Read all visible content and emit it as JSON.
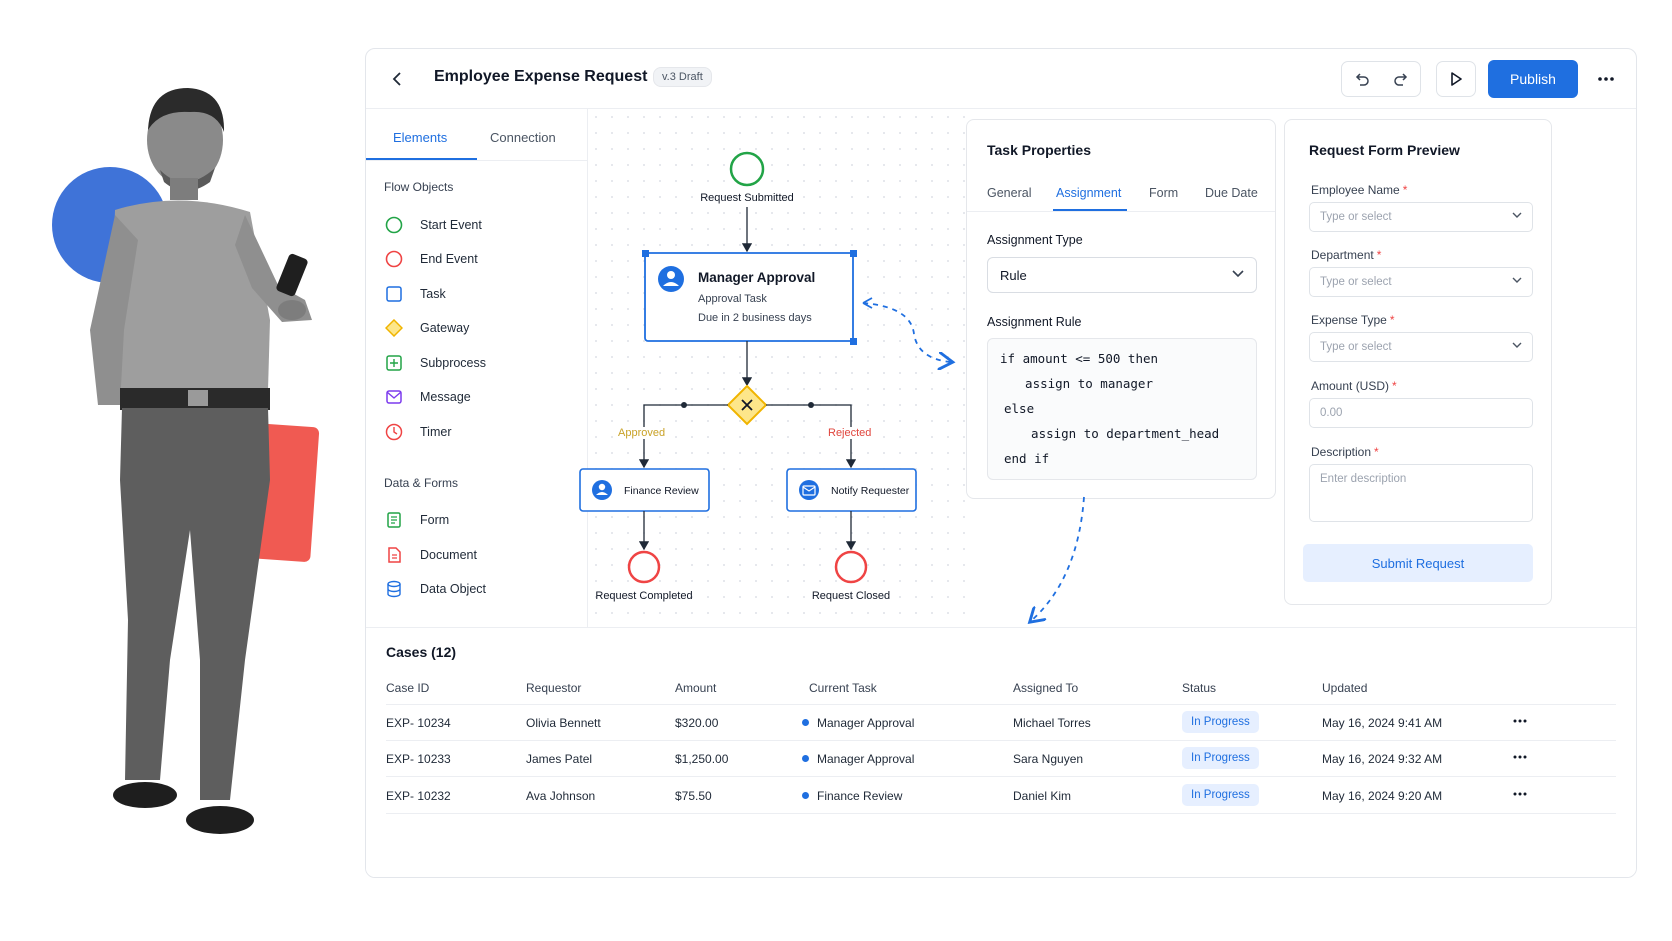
{
  "header": {
    "title": "Employee Expense Request",
    "version": "v.3 Draft",
    "publish_label": "Publish"
  },
  "palette": {
    "tabs": [
      "Elements",
      "Connection"
    ],
    "flow_objects_label": "Flow Objects",
    "flow_objects": [
      "Start Event",
      "End Event",
      "Task",
      "Gateway",
      "Subprocess",
      "Message",
      "Timer"
    ],
    "data_forms_label": "Data & Forms",
    "data_forms": [
      "Form",
      "Document",
      "Data Object"
    ]
  },
  "diagram": {
    "start_label": "Request Submitted",
    "main_task": {
      "title": "Manager Approval",
      "subtitle": "Approval Task",
      "due": "Due in 2 business days"
    },
    "approved_label": "Approved",
    "rejected_label": "Rejected",
    "finance_task": "Finance Review",
    "notify_task": "Notify Requester",
    "end_completed": "Request Completed",
    "end_closed": "Request Closed"
  },
  "task_properties": {
    "title": "Task Properties",
    "tabs": [
      "General",
      "Assignment",
      "Form",
      "Due Date"
    ],
    "assignment_type_label": "Assignment Type",
    "assignment_type_value": "Rule",
    "assignment_rule_label": "Assignment Rule",
    "code": [
      "if amount <= 500 then",
      "  assign to manager",
      "else",
      "  assign to department_head",
      "end if"
    ]
  },
  "form_preview": {
    "title": "Request Form Preview",
    "fields": [
      {
        "label": "Employee Name",
        "placeholder": "Type or select"
      },
      {
        "label": "Department",
        "placeholder": "Type or select"
      },
      {
        "label": "Expense Type",
        "placeholder": "Type or select"
      },
      {
        "label": "Amount (USD)",
        "placeholder": "0.00"
      },
      {
        "label": "Description",
        "placeholder": "Enter description"
      }
    ],
    "required_mark": "*",
    "submit_label": "Submit Request"
  },
  "cases": {
    "title": "Cases (12)",
    "columns": [
      "Case ID",
      "Requestor",
      "Amount",
      "Current Task",
      "Assigned To",
      "Status",
      "Updated"
    ],
    "rows": [
      {
        "id": "EXP- 10234",
        "requestor": "Olivia Bennett",
        "amount": "$320.00",
        "task": "Manager Approval",
        "assigned": "Michael Torres",
        "status": "In Progress",
        "updated": "May 16, 2024 9:41 AM"
      },
      {
        "id": "EXP- 10233",
        "requestor": "James Patel",
        "amount": "$1,250.00",
        "task": "Manager Approval",
        "assigned": "Sara Nguyen",
        "status": "In Progress",
        "updated": "May 16, 2024 9:32 AM"
      },
      {
        "id": "EXP- 10232",
        "requestor": "Ava Johnson",
        "amount": "$75.50",
        "task": "Finance Review",
        "assigned": "Daniel Kim",
        "status": "In Progress",
        "updated": "May 16, 2024 9:20 AM"
      }
    ]
  },
  "colors": {
    "accent": "#1f6fe0",
    "start": "#22a447",
    "end": "#ef4444",
    "gateway": "#f4c430",
    "approved": "#c9a227",
    "rejected": "#e0453d"
  }
}
